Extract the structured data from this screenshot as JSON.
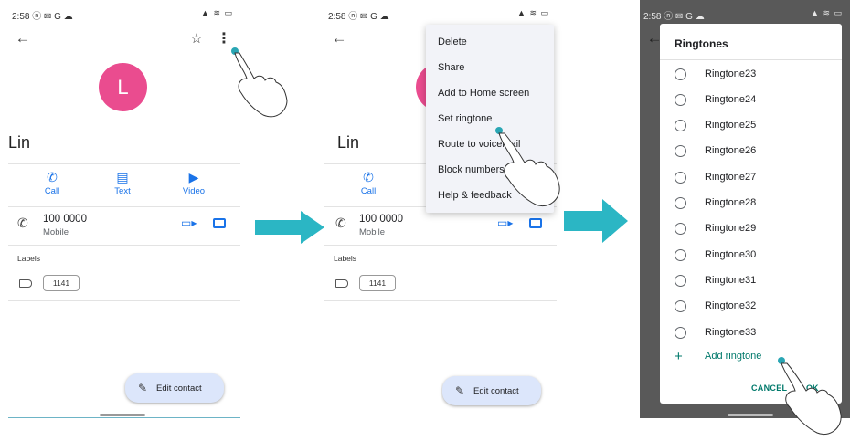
{
  "status": {
    "time": "2:58",
    "time_icons": "ⓝ ✉ G ☁",
    "sys_icons": "▲ ≋ ▭"
  },
  "contact": {
    "initial": "L",
    "name": "Lin",
    "actions": [
      {
        "label": "Call",
        "glyph": "✆"
      },
      {
        "label": "Text",
        "glyph": "▤"
      },
      {
        "label": "Video",
        "glyph": "▶"
      }
    ],
    "phone_number": "100 0000",
    "phone_type": "Mobile",
    "labels_header": "Labels",
    "label_chip": "1141",
    "edit_button": "Edit contact"
  },
  "menu": {
    "items": [
      "Delete",
      "Share",
      "Add to Home screen",
      "Set ringtone",
      "Route to voicemail",
      "Block numbers",
      "Help & feedback"
    ]
  },
  "dialog": {
    "title": "Ringtones",
    "options": [
      "Ringtone23",
      "Ringtone24",
      "Ringtone25",
      "Ringtone26",
      "Ringtone27",
      "Ringtone28",
      "Ringtone29",
      "Ringtone30",
      "Ringtone31",
      "Ringtone32",
      "Ringtone33"
    ],
    "add_label": "Add ringtone",
    "cancel_label": "CANCEL",
    "ok_label": "OK"
  },
  "colors": {
    "accent": "#1a73e8",
    "avatar": "#ea4c8f",
    "teal": "#00796b",
    "arrow": "#2bb6c4",
    "tap_dot": "#2aa6b4"
  }
}
